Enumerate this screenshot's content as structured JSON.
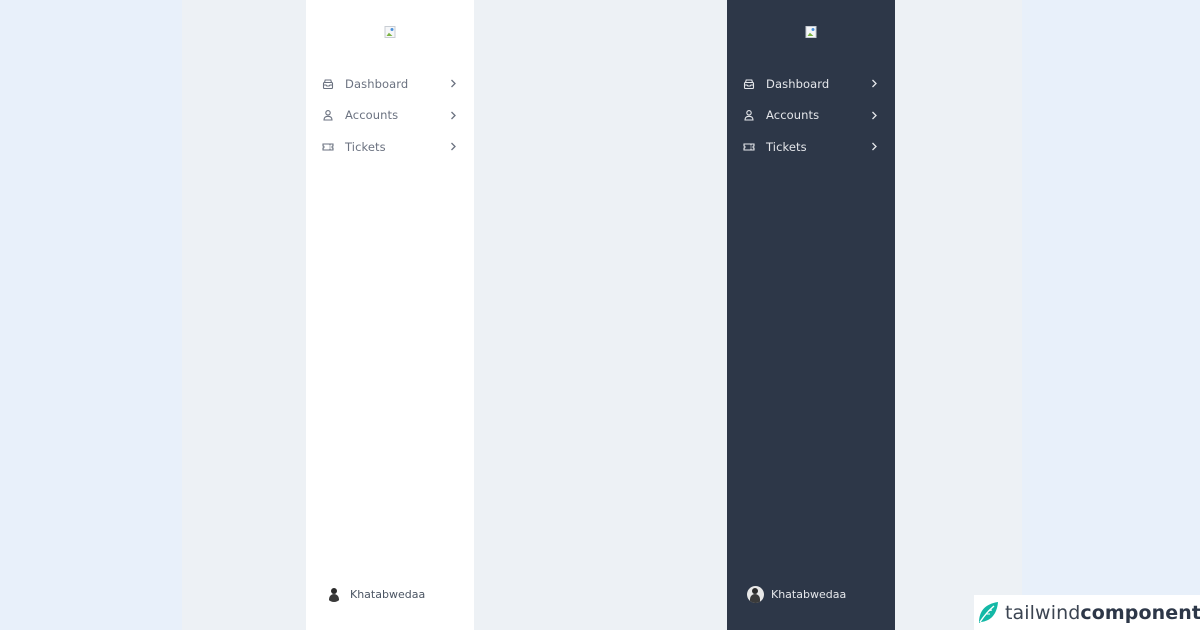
{
  "colors": {
    "page_bg": "#e8f0fa",
    "stage_bg": "#edf1f5",
    "light_sidebar_bg": "#ffffff",
    "dark_sidebar_bg": "#2d3748",
    "brand_accent": "#14b8a6"
  },
  "sidebars": [
    {
      "theme": "light",
      "logo_icon": "broken-image-icon",
      "nav": [
        {
          "label": "Dashboard",
          "icon": "inbox-stack-icon"
        },
        {
          "label": "Accounts",
          "icon": "user-icon"
        },
        {
          "label": "Tickets",
          "icon": "ticket-icon"
        }
      ],
      "user": {
        "name": "Khatabwedaa",
        "avatar_icon": "user-avatar-icon"
      }
    },
    {
      "theme": "dark",
      "logo_icon": "broken-image-icon",
      "nav": [
        {
          "label": "Dashboard",
          "icon": "inbox-stack-icon"
        },
        {
          "label": "Accounts",
          "icon": "user-icon"
        },
        {
          "label": "Tickets",
          "icon": "ticket-icon"
        }
      ],
      "user": {
        "name": "Khatabwedaa",
        "avatar_icon": "user-avatar-icon"
      }
    }
  ],
  "brand": {
    "light_part": "tailwind",
    "bold_part": "components",
    "icon": "leaf-logo-icon"
  }
}
